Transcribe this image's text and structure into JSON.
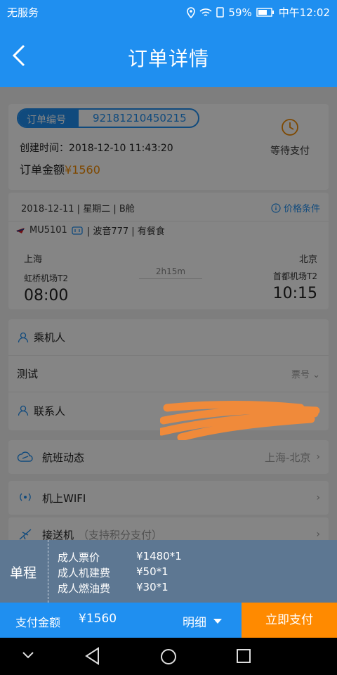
{
  "status_bar": {
    "carrier": "无服务",
    "battery": "59%",
    "time": "中午12:02"
  },
  "header": {
    "title": "订单详情"
  },
  "order": {
    "number_label": "订单编号",
    "number": "92181210450215",
    "created_label": "创建时间：",
    "created": "2018-12-10 11:43:20",
    "amount_label": "订单金额",
    "amount": "¥1560",
    "status": "等待支付"
  },
  "flight": {
    "date_info": "2018-12-11 | 星期二 | B舱",
    "price_conditions": "价格条件",
    "flight_no": "MU5101",
    "aircraft_meal": "| 波音777 | 有餐食",
    "dep_city": "上海",
    "dep_airport": "虹桥机场T2",
    "dep_time": "08:00",
    "duration": "2h15m",
    "arr_city": "北京",
    "arr_airport": "首都机场T2",
    "arr_time": "10:15"
  },
  "passengers": {
    "passenger_label": "乘机人",
    "passenger_name": "测试",
    "ticket_label": "票号",
    "contact_label": "联系人"
  },
  "services": {
    "flight_status": "航班动态",
    "flight_route": "上海-北京",
    "wifi": "机上WIFI",
    "transfer": "接送机",
    "transfer_note": "（支持积分支付）"
  },
  "breakdown": {
    "trip_type": "单程",
    "items": [
      {
        "label": "成人票价",
        "value": "¥1480*1"
      },
      {
        "label": "成人机建费",
        "value": "¥50*1"
      },
      {
        "label": "成人燃油费",
        "value": "¥30*1"
      }
    ]
  },
  "bottom": {
    "pay_label": "支付金额",
    "pay_amount": "¥1560",
    "detail": "明细",
    "pay_now": "立即支付"
  }
}
